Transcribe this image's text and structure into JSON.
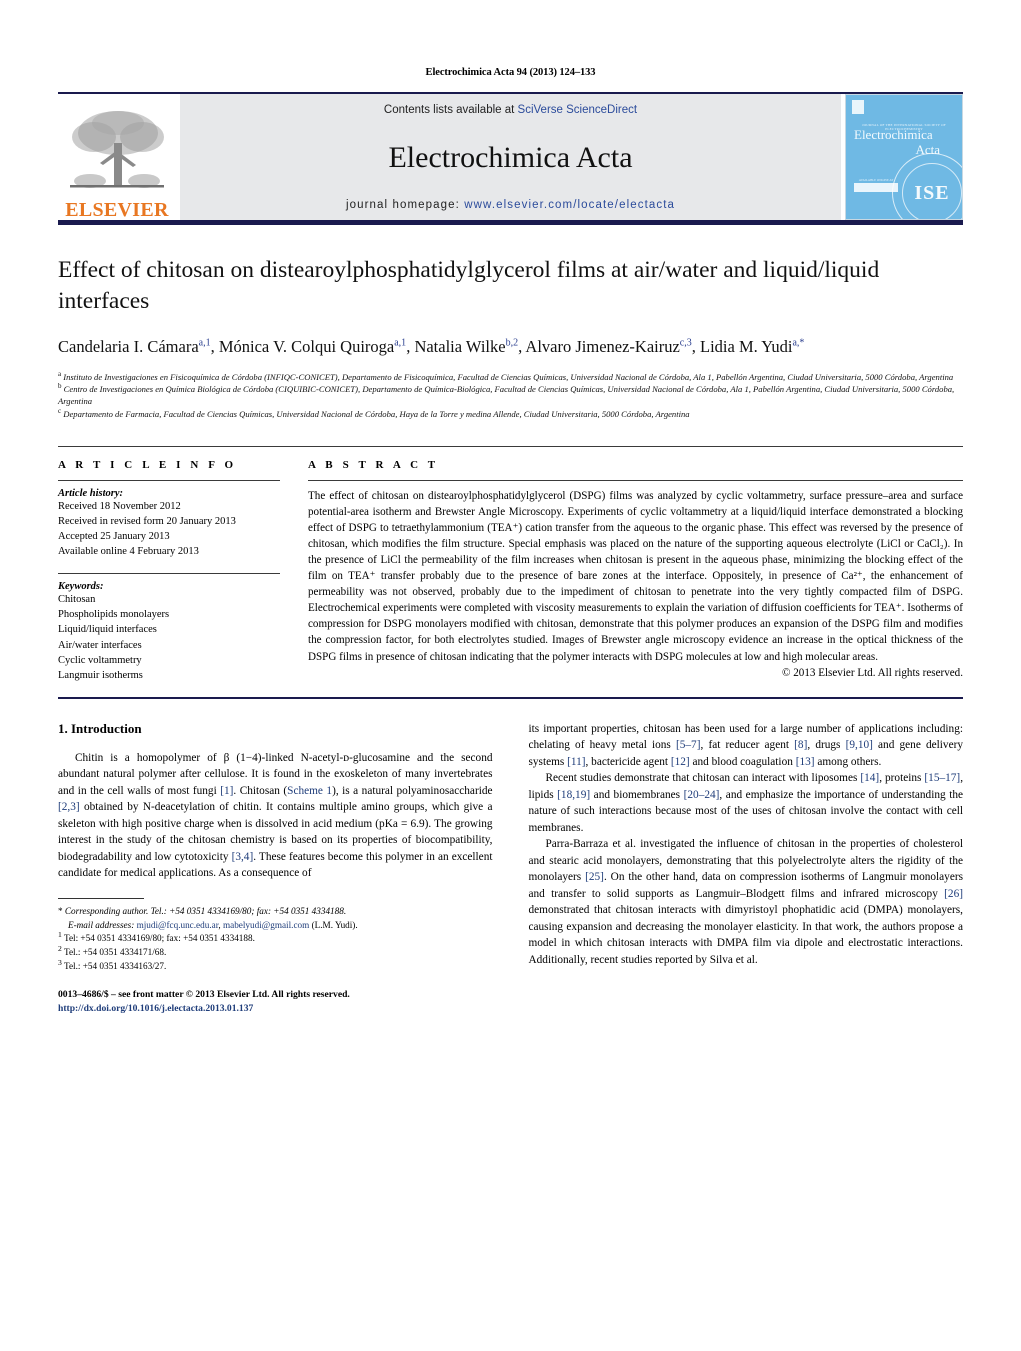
{
  "running_head": "Electrochimica Acta 94 (2013) 124–133",
  "masthead": {
    "elsevier_wordmark": "ELSEVIER",
    "contents_prefix": "Contents lists available at ",
    "sciencedirect_link": "SciVerse ScienceDirect",
    "journal_name": "Electrochimica Acta",
    "homepage_prefix": "journal homepage: ",
    "homepage_url": "www.elsevier.com/locate/electacta",
    "cover": {
      "society_line": "JOURNAL OF THE INTERNATIONAL SOCIETY OF ELECTROCHEMISTRY",
      "title_line1": "Electrochimica",
      "title_line2": "Acta",
      "badge_caption": "AVAILABLE ONLINE AT SCIENCEDIRECT.COM",
      "badge_text": "ScienceDirect",
      "seal_text": "ISE"
    }
  },
  "article": {
    "title": "Effect of chitosan on distearoylphosphatidylglycerol films at air/water and liquid/liquid interfaces",
    "authors": [
      {
        "name": "Candelaria I. Cámara",
        "marks": "a,1",
        "sep": ", "
      },
      {
        "name": "Mónica V. Colqui Quiroga",
        "marks": "a,1",
        "sep": ", "
      },
      {
        "name": "Natalia Wilke",
        "marks": "b,2",
        "sep": ", "
      },
      {
        "name": "Alvaro Jimenez-Kairuz",
        "marks": "c,3",
        "sep": ", "
      },
      {
        "name": "Lidia M. Yudi",
        "marks": "a,*",
        "sep": ""
      }
    ],
    "affiliations": [
      {
        "mark": "a",
        "text": "Instituto de Investigaciones en Fisicoquímica de Córdoba (INFIQC-CONICET), Departamento de Fisicoquímica, Facultad de Ciencias Químicas, Universidad Nacional de Córdoba, Ala 1, Pabellón Argentina, Ciudad Universitaria, 5000 Córdoba, Argentina"
      },
      {
        "mark": "b",
        "text": "Centro de Investigaciones en Química Biológica de Córdoba (CIQUIBIC-CONICET), Departamento de Química-Biológica, Facultad de Ciencias Químicas, Universidad Nacional de Córdoba, Ala 1, Pabellón Argentina, Ciudad Universitaria, 5000 Córdoba, Argentina"
      },
      {
        "mark": "c",
        "text": "Departamento de Farmacia, Facultad de Ciencias Químicas, Universidad Nacional de Córdoba, Haya de la Torre y medina Allende, Ciudad Universitaria, 5000 Córdoba, Argentina"
      }
    ]
  },
  "article_info": {
    "heading": "A R T I C L E    I N F O",
    "history_label": "Article history:",
    "history": [
      "Received 18 November 2012",
      "Received in revised form 20 January 2013",
      "Accepted 25 January 2013",
      "Available online 4 February 2013"
    ],
    "keywords_label": "Keywords:",
    "keywords": [
      "Chitosan",
      "Phospholipids monolayers",
      "Liquid/liquid interfaces",
      "Air/water interfaces",
      "Cyclic voltammetry",
      "Langmuir isotherms"
    ]
  },
  "abstract": {
    "heading": "A B S T R A C T",
    "text": "The effect of chitosan on distearoylphosphatidylglycerol (DSPG) films was analyzed by cyclic voltammetry, surface pressure–area and surface potential-area isotherm and Brewster Angle Microscopy. Experiments of cyclic voltammetry at a liquid/liquid interface demonstrated a blocking effect of DSPG to tetraethylammonium (TEA⁺) cation transfer from the aqueous to the organic phase. This effect was reversed by the presence of chitosan, which modifies the film structure. Special emphasis was placed on the nature of the supporting aqueous electrolyte (LiCl or CaCl₂). In the presence of LiCl the permeability of the film increases when chitosan is present in the aqueous phase, minimizing the blocking effect of the film on TEA⁺ transfer probably due to the presence of bare zones at the interface. Oppositely, in presence of Ca²⁺, the enhancement of permeability was not observed, probably due to the impediment of chitosan to penetrate into the very tightly compacted film of DSPG. Electrochemical experiments were completed with viscosity measurements to explain the variation of diffusion coefficients for TEA⁺. Isotherms of compression for DSPG monolayers modified with chitosan, demonstrate that this polymer produces an expansion of the DSPG film and modifies the compression factor, for both electrolytes studied. Images of Brewster angle microscopy evidence an increase in the optical thickness of the DSPG films in presence of chitosan indicating that the polymer interacts with DSPG molecules at low and high molecular areas.",
    "copyright": "© 2013 Elsevier Ltd. All rights reserved."
  },
  "introduction": {
    "section_number_title": "1.  Introduction",
    "left_paragraph_1": "Chitin is a homopolymer of β (1−4)-linked N-acetyl-ᴅ-glucosamine and the second abundant natural polymer after cellulose. It is found in the exoskeleton of many invertebrates and in the cell walls of most fungi [1]. Chitosan (Scheme 1), is a natural polyaminosaccharide [2,3] obtained by N-deacetylation of chitin. It contains multiple amino groups, which give a skeleton with high positive charge when is dissolved in acid medium (pKa = 6.9). The growing interest in the study of the chitosan chemistry is based on its properties of biocompatibility, biodegradability and low cytotoxicity [3,4]. These features become this polymer in an excellent candidate for medical applications. As a consequence of",
    "right_paragraph_1": "its important properties, chitosan has been used for a large number of applications including: chelating of heavy metal ions [5–7], fat reducer agent [8], drugs [9,10] and gene delivery systems [11], bactericide agent [12] and blood coagulation [13] among others.",
    "right_paragraph_2": "Recent studies demonstrate that chitosan can interact with liposomes [14], proteins [15–17], lipids [18,19] and biomembranes [20–24], and emphasize the importance of understanding the nature of such interactions because most of the uses of chitosan involve the contact with cell membranes.",
    "right_paragraph_3": "Parra-Barraza et al. investigated the influence of chitosan in the properties of cholesterol and stearic acid monolayers, demonstrating that this polyelectrolyte alters the rigidity of the monolayers [25]. On the other hand, data on compression isotherms of Langmuir monolayers and transfer to solid supports as Langmuir–Blodgett films and infrared microscopy [26] demonstrated that chitosan interacts with dimyristoyl phophatidic acid (DMPA) monolayers, causing expansion and decreasing the monolayer elasticity. In that work, the authors propose a model in which chitosan interacts with DMPA film via dipole and electrostatic interactions. Additionally, recent studies reported by Silva et al."
  },
  "footnotes": {
    "corresponding": "Corresponding author. Tel.: +54 0351 4334169/80; fax: +54 0351 4334188.",
    "email_label": "E-mail addresses:",
    "email_1": "mjudi@fcq.unc.edu.ar",
    "email_2": "mabelyudi@gmail.com",
    "email_owner": "(L.M. Yudi).",
    "note_1": "Tel: +54 0351 4334169/80; fax: +54 0351 4334188.",
    "note_2": "Tel.: +54 0351 4334171/68.",
    "note_3": "Tel.: +54 0351 4334163/27.",
    "issn_line": "0013–4686/$ – see front matter © 2013 Elsevier Ltd. All rights reserved.",
    "doi": "http://dx.doi.org/10.1016/j.electacta.2013.01.137"
  },
  "colors": {
    "navy": "#1a1a4e",
    "link": "#2b4b9b",
    "elsevier_orange": "#E87722",
    "cover_blue": "#6fb9e4",
    "banner_grey": "#e7e8ea"
  }
}
